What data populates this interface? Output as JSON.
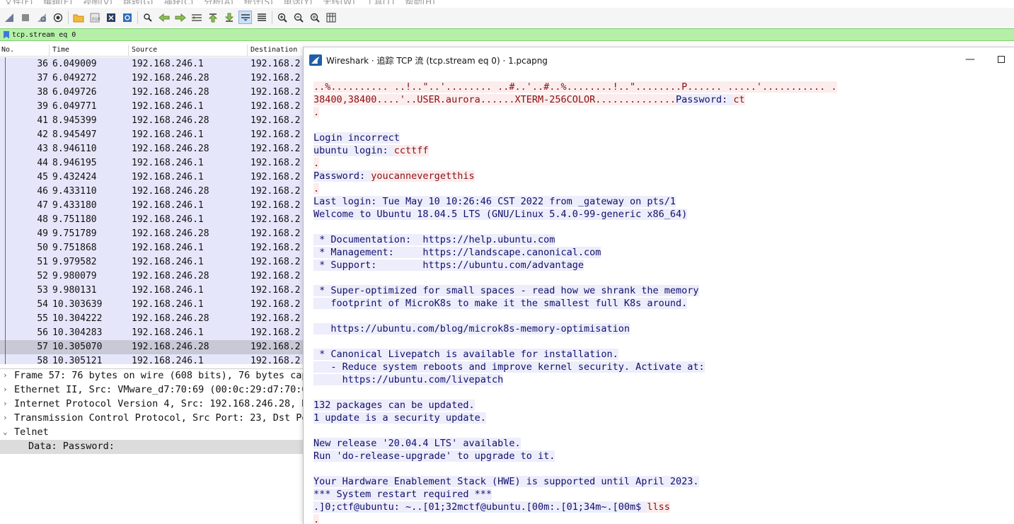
{
  "menubar": [
    "文件(F)",
    "编辑(E)",
    "视图(V)",
    "跳转(G)",
    "捕获(C)",
    "分析(A)",
    "统计(S)",
    "电话(Y)",
    "无线(W)",
    "工具(T)",
    "帮助(H)"
  ],
  "filter": {
    "value": "tcp.stream eq 0"
  },
  "columns": {
    "no": "No.",
    "time": "Time",
    "source": "Source",
    "destination": "Destination"
  },
  "packets": [
    {
      "no": "36",
      "time": "6.049009",
      "src": "192.168.246.1",
      "dst": "192.168.2"
    },
    {
      "no": "37",
      "time": "6.049272",
      "src": "192.168.246.28",
      "dst": "192.168.2"
    },
    {
      "no": "38",
      "time": "6.049726",
      "src": "192.168.246.28",
      "dst": "192.168.2"
    },
    {
      "no": "39",
      "time": "6.049771",
      "src": "192.168.246.1",
      "dst": "192.168.2"
    },
    {
      "no": "41",
      "time": "8.945399",
      "src": "192.168.246.28",
      "dst": "192.168.2"
    },
    {
      "no": "42",
      "time": "8.945497",
      "src": "192.168.246.1",
      "dst": "192.168.2"
    },
    {
      "no": "43",
      "time": "8.946110",
      "src": "192.168.246.28",
      "dst": "192.168.2"
    },
    {
      "no": "44",
      "time": "8.946195",
      "src": "192.168.246.1",
      "dst": "192.168.2"
    },
    {
      "no": "45",
      "time": "9.432424",
      "src": "192.168.246.1",
      "dst": "192.168.2"
    },
    {
      "no": "46",
      "time": "9.433110",
      "src": "192.168.246.28",
      "dst": "192.168.2"
    },
    {
      "no": "47",
      "time": "9.433180",
      "src": "192.168.246.1",
      "dst": "192.168.2"
    },
    {
      "no": "48",
      "time": "9.751180",
      "src": "192.168.246.1",
      "dst": "192.168.2"
    },
    {
      "no": "49",
      "time": "9.751789",
      "src": "192.168.246.28",
      "dst": "192.168.2"
    },
    {
      "no": "50",
      "time": "9.751868",
      "src": "192.168.246.1",
      "dst": "192.168.2"
    },
    {
      "no": "51",
      "time": "9.979582",
      "src": "192.168.246.1",
      "dst": "192.168.2"
    },
    {
      "no": "52",
      "time": "9.980079",
      "src": "192.168.246.28",
      "dst": "192.168.2"
    },
    {
      "no": "53",
      "time": "9.980131",
      "src": "192.168.246.1",
      "dst": "192.168.2"
    },
    {
      "no": "54",
      "time": "10.303639",
      "src": "192.168.246.1",
      "dst": "192.168.2"
    },
    {
      "no": "55",
      "time": "10.304222",
      "src": "192.168.246.28",
      "dst": "192.168.2"
    },
    {
      "no": "56",
      "time": "10.304283",
      "src": "192.168.246.1",
      "dst": "192.168.2"
    },
    {
      "no": "57",
      "time": "10.305070",
      "src": "192.168.246.28",
      "dst": "192.168.2"
    },
    {
      "no": "58",
      "time": "10.305121",
      "src": "192.168.246.1",
      "dst": "192.168.2"
    }
  ],
  "selected_packet": "57",
  "details": [
    {
      "text": "Frame 57: 76 bytes on wire (608 bits), 76 bytes cap",
      "expanded": false
    },
    {
      "text": "Ethernet II, Src: VMware_d7:70:69 (00:0c:29:d7:70:6",
      "expanded": false
    },
    {
      "text": "Internet Protocol Version 4, Src: 192.168.246.28, D",
      "expanded": false
    },
    {
      "text": "Transmission Control Protocol, Src Port: 23, Dst Po",
      "expanded": false
    },
    {
      "text": "Telnet",
      "expanded": true
    },
    {
      "text": "Data: Password:",
      "child": true
    }
  ],
  "dialog": {
    "title": "Wireshark · 追踪 TCP 流 (tcp.stream eq 0) · 1.pcapng",
    "minimize": "—",
    "lines": [
      {
        "who": "c",
        "text": "..%.......... ..!..\"..'........ ..#..'..#..%........!..\"........P...... .....'........... ."
      },
      {
        "segs": [
          {
            "who": "c",
            "text": "38400,38400....'..USER.aurora......XTERM-256COLOR.............."
          },
          {
            "who": "s",
            "text": "Password: "
          },
          {
            "who": "c",
            "text": "ct"
          }
        ]
      },
      {
        "who": "c",
        "text": "."
      },
      {
        "who": "",
        "text": ""
      },
      {
        "who": "s",
        "text": "Login incorrect"
      },
      {
        "segs": [
          {
            "who": "s",
            "text": "ubuntu login: "
          },
          {
            "who": "c",
            "text": "ccttff"
          }
        ]
      },
      {
        "who": "c",
        "text": "."
      },
      {
        "segs": [
          {
            "who": "s",
            "text": "Password: "
          },
          {
            "who": "c",
            "text": "youcannevergetthis"
          }
        ]
      },
      {
        "who": "c",
        "text": "."
      },
      {
        "who": "s",
        "text": "Last login: Tue May 10 10:26:46 CST 2022 from _gateway on pts/1"
      },
      {
        "who": "s",
        "text": "Welcome to Ubuntu 18.04.5 LTS (GNU/Linux 5.4.0-99-generic x86_64)"
      },
      {
        "who": "",
        "text": ""
      },
      {
        "who": "s",
        "text": " * Documentation:  https://help.ubuntu.com"
      },
      {
        "who": "s",
        "text": " * Management:     https://landscape.canonical.com"
      },
      {
        "who": "s",
        "text": " * Support:        https://ubuntu.com/advantage"
      },
      {
        "who": "",
        "text": ""
      },
      {
        "who": "s",
        "text": " * Super-optimized for small spaces - read how we shrank the memory"
      },
      {
        "who": "s",
        "text": "   footprint of MicroK8s to make it the smallest full K8s around."
      },
      {
        "who": "",
        "text": ""
      },
      {
        "who": "s",
        "text": "   https://ubuntu.com/blog/microk8s-memory-optimisation"
      },
      {
        "who": "",
        "text": ""
      },
      {
        "who": "s",
        "text": " * Canonical Livepatch is available for installation."
      },
      {
        "who": "s",
        "text": "   - Reduce system reboots and improve kernel security. Activate at:"
      },
      {
        "who": "s",
        "text": "     https://ubuntu.com/livepatch"
      },
      {
        "who": "",
        "text": ""
      },
      {
        "who": "s",
        "text": "132 packages can be updated."
      },
      {
        "who": "s",
        "text": "1 update is a security update."
      },
      {
        "who": "",
        "text": ""
      },
      {
        "who": "s",
        "text": "New release '20.04.4 LTS' available."
      },
      {
        "who": "s",
        "text": "Run 'do-release-upgrade' to upgrade to it."
      },
      {
        "who": "",
        "text": ""
      },
      {
        "who": "s",
        "text": "Your Hardware Enablement Stack (HWE) is supported until April 2023."
      },
      {
        "who": "s",
        "text": "*** System restart required ***"
      },
      {
        "segs": [
          {
            "who": "s",
            "text": ".]0;ctf@ubuntu: ~..[01;32mctf@ubuntu.[00m:.[01;34m~.[00m$ "
          },
          {
            "who": "c",
            "text": "llss"
          }
        ]
      },
      {
        "who": "c",
        "text": "."
      }
    ]
  },
  "colors": {
    "filter_bg": "#b6f0a8",
    "row_bg": "#e6e6fb",
    "selected_row_bg": "#c8c8d6",
    "client_bg": "#fbeded",
    "client_fg": "#8b0f13",
    "server_bg": "#ededfb",
    "server_fg": "#10106b"
  },
  "toolbar_icons": [
    "shark-fin-start-icon",
    "stop-icon",
    "restart-icon",
    "options-icon",
    "open-folder-icon",
    "save-icon",
    "close-file-icon",
    "reload-icon",
    "find-icon",
    "back-icon",
    "forward-icon",
    "go-to-icon",
    "first-packet-icon",
    "last-packet-icon",
    "autoscroll-icon",
    "colorize-icon",
    "zoom-in-icon",
    "zoom-out-icon",
    "zoom-normal-icon",
    "resize-columns-icon"
  ]
}
